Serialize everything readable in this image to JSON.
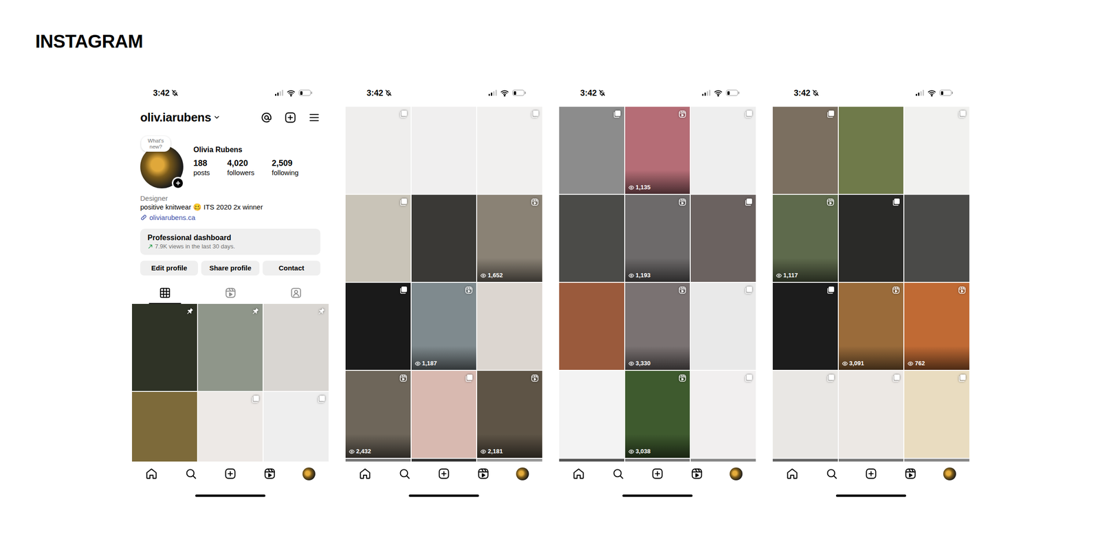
{
  "page": {
    "title": "INSTAGRAM"
  },
  "nav": [
    {
      "kind": "home"
    },
    {
      "kind": "search"
    },
    {
      "kind": "create"
    },
    {
      "kind": "reels"
    },
    {
      "kind": "profile"
    }
  ],
  "phones": [
    {
      "status_bar": {
        "time": "3:42",
        "signal": {
          "level": 0.5
        },
        "battery": {
          "level": 0.25
        }
      },
      "profile": {
        "username": "oliv.iarubens",
        "note": "What's new?",
        "name": "Olivia Rubens",
        "stats": [
          {
            "value": "188",
            "label": "posts"
          },
          {
            "value": "4,020",
            "label": "followers"
          },
          {
            "value": "2,509",
            "label": "following"
          }
        ],
        "category": "Designer",
        "bio": "positive knitwear 🥴 ITS 2020 2x winner",
        "link": "oliviarubens.ca",
        "dashboard": {
          "title": "Professional dashboard",
          "subtitle": "7.9K views in the last 30 days."
        },
        "buttons": [
          "Edit profile",
          "Share profile",
          "Contact"
        ],
        "tabs": [
          {
            "kind": "posts",
            "selected": true
          },
          {
            "kind": "reels",
            "selected": false
          },
          {
            "kind": "tagged",
            "selected": false
          }
        ]
      },
      "grid": [
        {
          "kind": "pinned"
        },
        {
          "kind": "pinned"
        },
        {
          "kind": "pinned"
        },
        {
          "kind": "photo"
        },
        {
          "kind": "carousel"
        },
        {
          "kind": "carousel"
        }
      ]
    },
    {
      "status_bar": {
        "time": "3:42",
        "signal": {
          "level": 0.5
        },
        "battery": {
          "level": 0.25
        }
      },
      "grid": [
        {
          "kind": "carousel"
        },
        {
          "kind": "photo"
        },
        {
          "kind": "carousel"
        },
        {
          "kind": "carousel"
        },
        {
          "kind": "photo"
        },
        {
          "kind": "reel",
          "views": "1,652"
        },
        {
          "kind": "carousel"
        },
        {
          "kind": "reel",
          "views": "1,187"
        },
        {
          "kind": "photo"
        },
        {
          "kind": "reel",
          "views": "2,432"
        },
        {
          "kind": "carousel"
        },
        {
          "kind": "reel",
          "views": "2,181"
        },
        {
          "kind": "photo"
        },
        {
          "kind": "photo"
        },
        {
          "kind": "photo"
        }
      ]
    },
    {
      "status_bar": {
        "time": "3:42",
        "signal": {
          "level": 0.5
        },
        "battery": {
          "level": 0.25
        }
      },
      "grid": [
        {
          "kind": "carousel"
        },
        {
          "kind": "reel",
          "views": "1,135"
        },
        {
          "kind": "carousel"
        },
        {
          "kind": "photo"
        },
        {
          "kind": "reel",
          "views": "1,193"
        },
        {
          "kind": "carousel"
        },
        {
          "kind": "photo"
        },
        {
          "kind": "reel",
          "views": "3,330"
        },
        {
          "kind": "carousel"
        },
        {
          "kind": "photo"
        },
        {
          "kind": "reel",
          "views": "3,038"
        },
        {
          "kind": "carousel"
        },
        {
          "kind": "photo"
        },
        {
          "kind": "photo"
        },
        {
          "kind": "photo"
        }
      ]
    },
    {
      "status_bar": {
        "time": "3:42",
        "signal": {
          "level": 0.5
        },
        "battery": {
          "level": 0.25
        }
      },
      "grid": [
        {
          "kind": "carousel"
        },
        {
          "kind": "photo"
        },
        {
          "kind": "carousel"
        },
        {
          "kind": "reel",
          "views": "1,117"
        },
        {
          "kind": "carousel"
        },
        {
          "kind": "photo"
        },
        {
          "kind": "carousel"
        },
        {
          "kind": "reel",
          "views": "3,091"
        },
        {
          "kind": "reel",
          "views": "762"
        },
        {
          "kind": "carousel"
        },
        {
          "kind": "carousel"
        },
        {
          "kind": "carousel"
        },
        {
          "kind": "photo"
        },
        {
          "kind": "photo"
        },
        {
          "kind": "photo"
        }
      ]
    }
  ]
}
